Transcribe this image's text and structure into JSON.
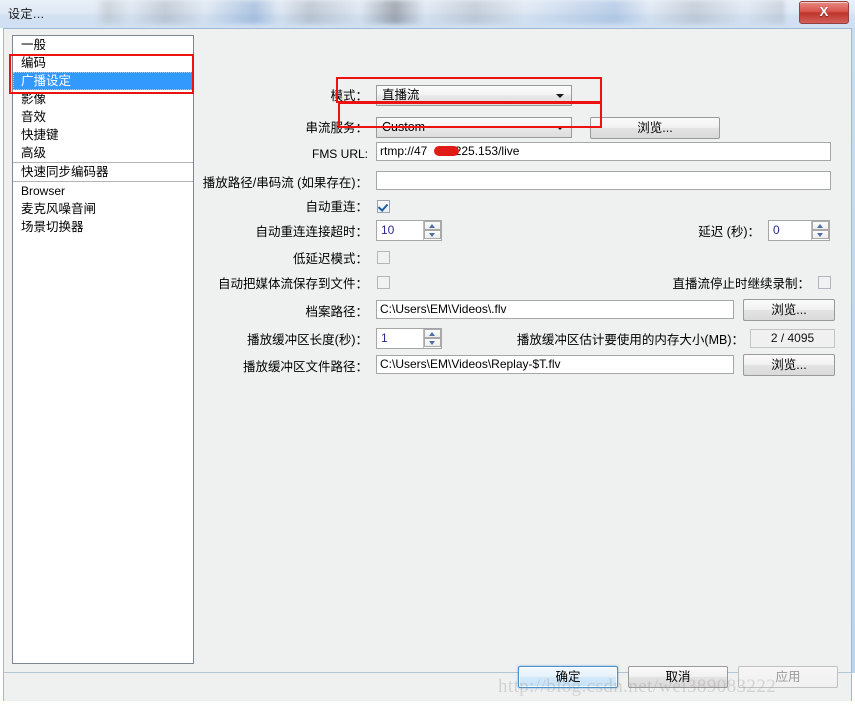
{
  "window": {
    "title": "设定...",
    "close_label": "X"
  },
  "sidebar": {
    "items": [
      {
        "label": "一般",
        "selected": false,
        "sep": "none",
        "latin": false
      },
      {
        "label": "编码",
        "selected": false,
        "sep": "none",
        "latin": false
      },
      {
        "label": "广播设定",
        "selected": true,
        "sep": "none",
        "latin": false
      },
      {
        "label": "影像",
        "selected": false,
        "sep": "none",
        "latin": false
      },
      {
        "label": "音效",
        "selected": false,
        "sep": "none",
        "latin": false
      },
      {
        "label": "快捷键",
        "selected": false,
        "sep": "none",
        "latin": false
      },
      {
        "label": "高级",
        "selected": false,
        "sep": "none",
        "latin": false
      },
      {
        "label": "快速同步编码器",
        "selected": false,
        "sep": "both",
        "latin": false
      },
      {
        "label": "Browser",
        "selected": false,
        "sep": "none",
        "latin": true
      },
      {
        "label": "麦克风噪音闸",
        "selected": false,
        "sep": "none",
        "latin": false
      },
      {
        "label": "场景切换器",
        "selected": false,
        "sep": "none",
        "latin": false
      }
    ]
  },
  "form": {
    "mode": {
      "label": "模式：",
      "value": "直播流"
    },
    "stream_service": {
      "label": "串流服务：",
      "value": "Custom",
      "browse_label": "浏览..."
    },
    "fms_url": {
      "label": "FMS URL:",
      "value": "rtmp://47███.225.153/live",
      "value_prefix": "rtmp://47",
      "value_suffix": ".225.153/live"
    },
    "play_path": {
      "label": "播放路径/串码流 (如果存在)：",
      "value": ""
    },
    "auto_reconnect": {
      "label": "自动重连：",
      "checked": true
    },
    "reconnect_timeout": {
      "label": "自动重连连接超时：",
      "value": "10"
    },
    "delay_seconds": {
      "label": "延迟 (秒)：",
      "value": "0"
    },
    "low_latency": {
      "label": "低延迟模式：",
      "checked": false
    },
    "auto_save_stream": {
      "label": "自动把媒体流保存到文件：",
      "checked": false
    },
    "keep_recording": {
      "label": "直播流停止时继续录制：",
      "checked": false
    },
    "file_path": {
      "label": "档案路径：",
      "value": "C:\\Users\\EM\\Videos\\.flv",
      "browse_label": "浏览..."
    },
    "buffer_length": {
      "label": "播放缓冲区长度(秒)：",
      "value": "1"
    },
    "buffer_memory": {
      "label": "播放缓冲区估计要使用的内存大小(MB)：",
      "value": "2 / 4095"
    },
    "buffer_file_path": {
      "label": "播放缓冲区文件路径：",
      "value": "C:\\Users\\EM\\Videos\\Replay-$T.flv",
      "browse_label": "浏览..."
    }
  },
  "footer": {
    "ok_label": "确定",
    "cancel_label": "取消",
    "apply_label": "应用"
  },
  "watermark": {
    "text": "http://blog.csdn.net/wei389083222"
  },
  "colors": {
    "selection_blue": "#3399ff",
    "annotation_red": "#ee1111",
    "close_red": "#bf342b"
  }
}
